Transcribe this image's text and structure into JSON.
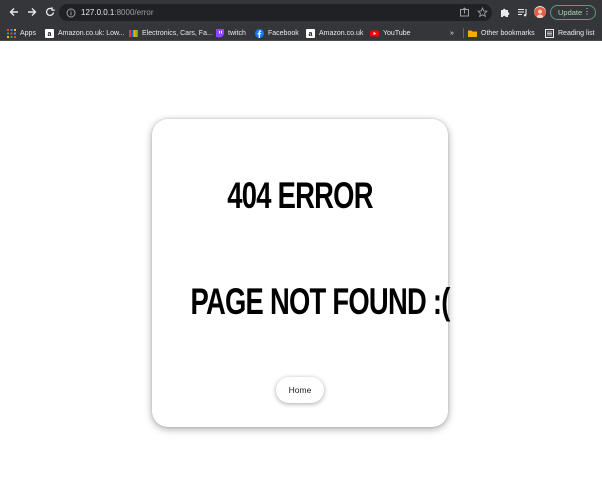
{
  "browser": {
    "url_host": "127.0.0.1",
    "url_path": ":8000/error",
    "update_label": "Update"
  },
  "bookmarks": {
    "items": [
      {
        "label": "Apps",
        "icon": "apps-grid-icon"
      },
      {
        "label": "Amazon.co.uk: Low...",
        "icon": "amazon-icon"
      },
      {
        "label": "Electronics, Cars, Fa...",
        "icon": "ebay-icon"
      },
      {
        "label": "twitch",
        "icon": "twitch-icon"
      },
      {
        "label": "Facebook",
        "icon": "facebook-icon"
      },
      {
        "label": "Amazon.co.uk",
        "icon": "amazon-icon"
      },
      {
        "label": "YouTube",
        "icon": "youtube-icon"
      }
    ],
    "overflow_label": "»",
    "other_bookmarks_label": "Other bookmarks",
    "reading_list_label": "Reading list"
  },
  "page": {
    "title": "404 ERROR",
    "message": "PAGE NOT FOUND :(",
    "home_button_label": "Home"
  },
  "colors": {
    "toolbar_bg": "#35363a",
    "omnibox_bg": "#202124",
    "page_bg": "#ffffff",
    "heading_text": "#000000",
    "update_button_text": "#a8dab5"
  }
}
